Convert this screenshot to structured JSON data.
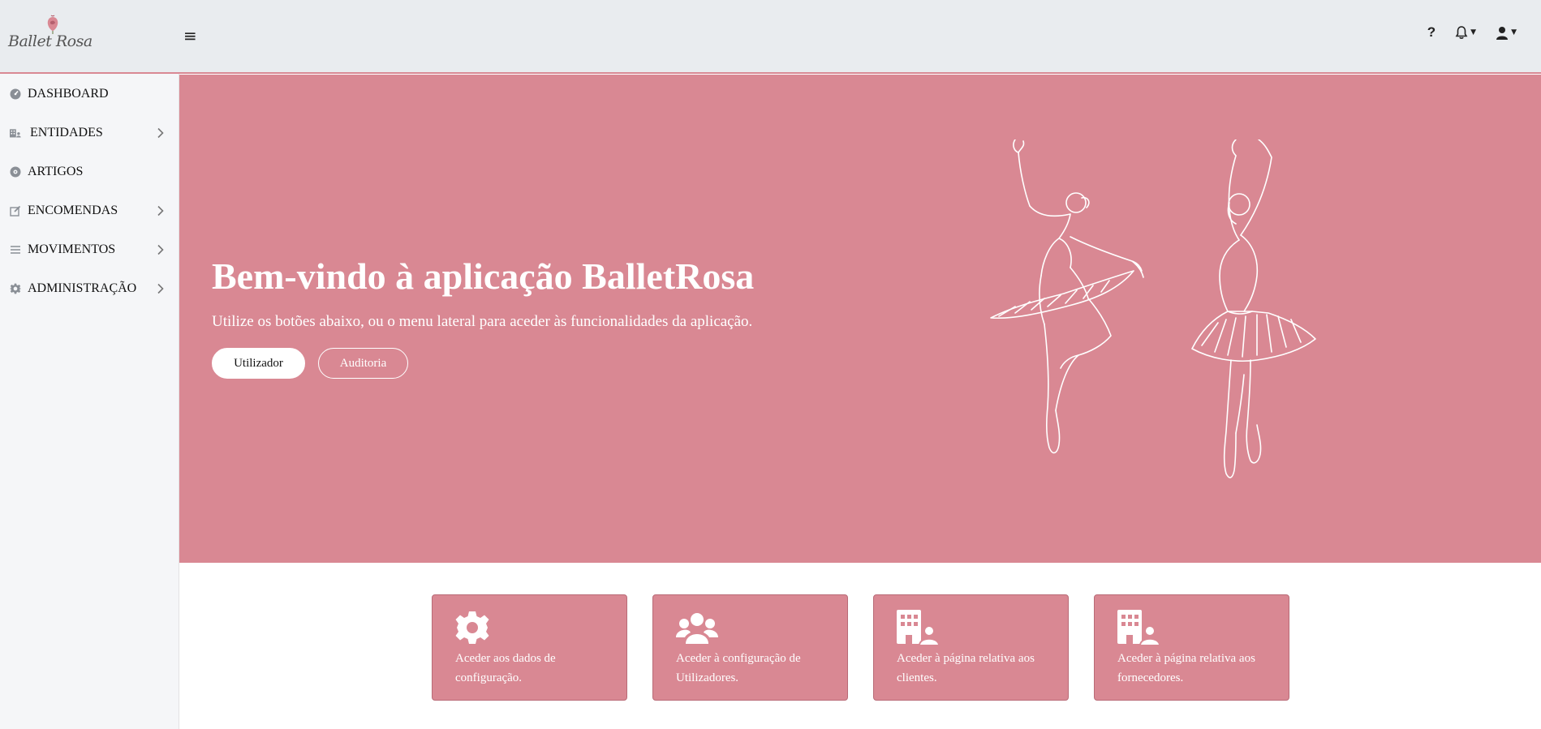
{
  "app": {
    "logo_text": "Ballet Rosa",
    "brand_color": "#d98893"
  },
  "header": {
    "menu_icon": "hamburger-icon",
    "help_label": "?",
    "notifications_icon": "bell-icon",
    "user_icon": "user-icon"
  },
  "sidebar": {
    "items": [
      {
        "label": "DASHBOARD",
        "icon": "dashboard-icon",
        "has_submenu": false
      },
      {
        "label": "ENTIDADES",
        "icon": "building-users-icon",
        "has_submenu": true
      },
      {
        "label": "ARTIGOS",
        "icon": "disc-icon",
        "has_submenu": false
      },
      {
        "label": "ENCOMENDAS",
        "icon": "edit-icon",
        "has_submenu": true
      },
      {
        "label": "MOVIMENTOS",
        "icon": "list-icon",
        "has_submenu": true
      },
      {
        "label": "ADMINISTRAÇÃO",
        "icon": "gear-icon",
        "has_submenu": true
      }
    ]
  },
  "hero": {
    "title": "Bem-vindo à aplicação BalletRosa",
    "subtitle": "Utilize os botões abaixo, ou o menu lateral para aceder às funcionalidades da aplicação.",
    "primary_button": "Utilizador",
    "secondary_button": "Auditoria"
  },
  "cards": [
    {
      "icon": "gear-icon",
      "text": "Aceder aos dados de configuração."
    },
    {
      "icon": "users-icon",
      "text": "Aceder à configuração de Utilizadores."
    },
    {
      "icon": "building-user-icon",
      "text": "Aceder à página relativa aos clientes."
    },
    {
      "icon": "building-user-icon",
      "text": "Aceder à página relativa aos fornecedores."
    }
  ]
}
